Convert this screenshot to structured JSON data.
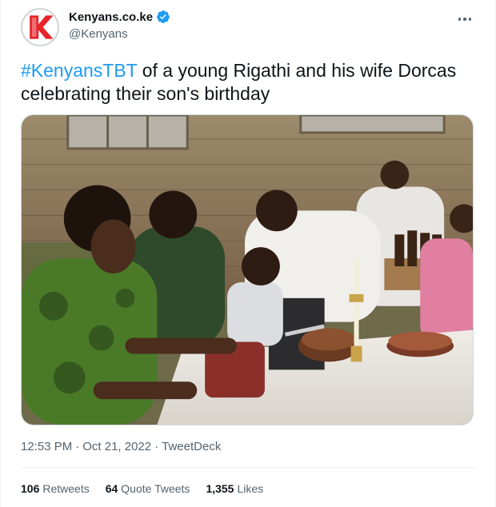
{
  "author": {
    "name": "Kenyans.co.ke",
    "handle": "@Kenyans",
    "verified": true,
    "avatar_letter": "K",
    "brand_color": "#e8232a"
  },
  "tweet": {
    "hashtag": "#KenyansTBT",
    "text": " of a young Rigathi and his wife Dorcas celebrating their son's birthday"
  },
  "meta": {
    "time": "12:53 PM",
    "separator1": "·",
    "date": "Oct 21, 2022",
    "separator2": "·",
    "source": "TweetDeck"
  },
  "stats": [
    {
      "count": "106",
      "label": "Retweets"
    },
    {
      "count": "64",
      "label": "Quote Tweets"
    },
    {
      "count": "1,355",
      "label": "Likes"
    }
  ],
  "colors": {
    "link": "#1d9bf0",
    "secondary": "#536471",
    "primary": "#0f1419",
    "divider": "#eff3f4"
  },
  "icons": {
    "verified": "verified-badge-icon",
    "more": "more-options-icon"
  }
}
